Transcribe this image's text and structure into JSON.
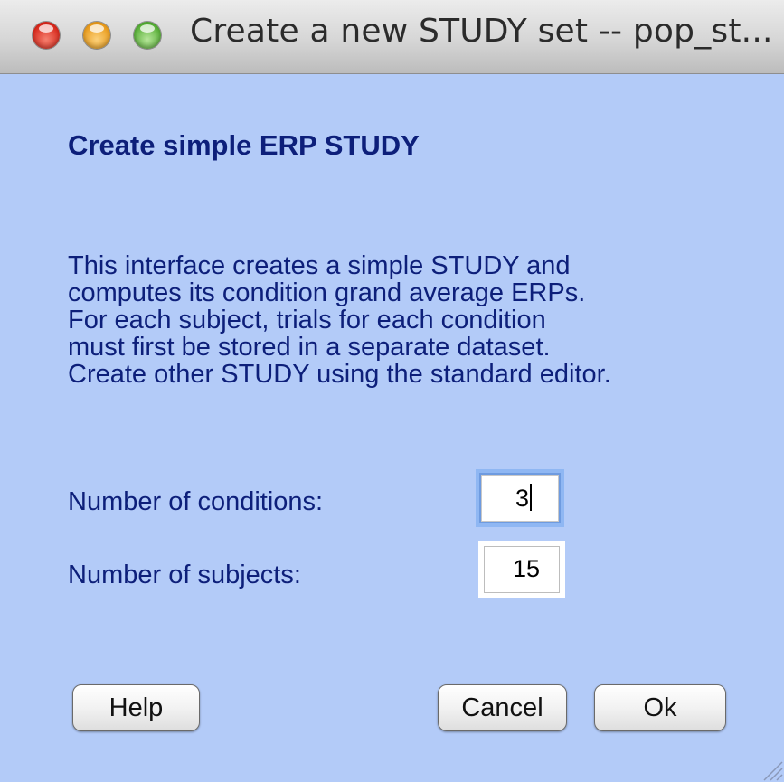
{
  "window": {
    "title": "Create a new STUDY set -- pop_st..."
  },
  "dialog": {
    "heading": "Create simple ERP STUDY",
    "description_lines": [
      "This interface creates a simple STUDY and",
      "computes its condition grand average ERPs.",
      "For each subject, trials for each condition",
      "must first be stored in a separate dataset.",
      "Create other STUDY using the standard editor."
    ],
    "fields": {
      "conditions": {
        "label": "Number of conditions:",
        "value": "3"
      },
      "subjects": {
        "label": "Number of subjects:",
        "value": "15"
      }
    },
    "buttons": {
      "help": "Help",
      "cancel": "Cancel",
      "ok": "Ok"
    }
  },
  "colors": {
    "background": "#b3cbf8",
    "text": "#0d1f7a"
  },
  "icons": {
    "close": "close-button-icon",
    "minimize": "minimize-button-icon",
    "zoom": "zoom-button-icon",
    "resize": "resize-grip-icon"
  }
}
